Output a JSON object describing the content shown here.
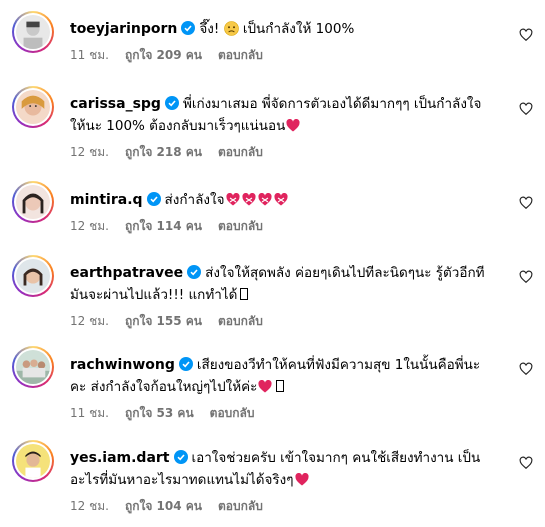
{
  "comments": [
    {
      "username": "toeyjarinporn",
      "text_before": "จึ๊ง! ",
      "text_after": " เป็นกำลังให้ 100%",
      "time": "11 ชม.",
      "likes": "ถูกใจ 209 คน",
      "reply": "ตอบกลับ"
    },
    {
      "username": "carissa_spg",
      "line1": "พี่เก่งมาเสมอ พี่จัดการตัวเองได้ดีมากๆๆ เป็นกำลังใจ",
      "line2": "ให้นะ 100% ต้องกลับมาเร็วๆแน่นอน",
      "time": "12 ชม.",
      "likes": "ถูกใจ 218 คน",
      "reply": "ตอบกลับ"
    },
    {
      "username": "mintira.q",
      "text": "ส่งกำลังใจ",
      "time": "12 ชม.",
      "likes": "ถูกใจ 114 คน",
      "reply": "ตอบกลับ"
    },
    {
      "username": "earthpatravee",
      "line1": "ส่งใจให้สุดพลัง ค่อยๆเดินไปทีละนิดๆนะ รู้ตัวอีกที",
      "line2": "มันจะผ่านไปแล้ว!!! แกทำได้",
      "time": "12 ชม.",
      "likes": "ถูกใจ 155 คน",
      "reply": "ตอบกลับ"
    },
    {
      "username": "rachwinwong",
      "line1": "เสียงของวีทำให้คนที่ฟังมีความสุข 1ในนั้นคือพี่นะ",
      "line2": "คะ ส่งกำลังใจก้อนใหญ่ๆไปให้ค่ะ",
      "time": "11 ชม.",
      "likes": "ถูกใจ 53 คน",
      "reply": "ตอบกลับ"
    },
    {
      "username": "yes.iam.dart",
      "line1": "เอาใจช่วยครับ เข้าใจมากๆ คนใช้เสียงทำงาน เป็น",
      "line2": "อะไรที่มันหาอะไรมาทดแทนไม่ได้จริงๆ",
      "time": "12 ชม.",
      "likes": "ถูกใจ 104 คน",
      "reply": "ตอบกลับ"
    }
  ],
  "colors": {
    "verified": "#0095f6",
    "meta_text": "#737373",
    "heart_red": "#e0245e"
  },
  "icons": {
    "verified": "verified-badge-icon",
    "like": "heart-outline-icon",
    "emoji_heart": "red-heart-emoji",
    "emoji_mending": "mending-heart-emoji",
    "emoji_sad": "sad-face-emoji"
  }
}
